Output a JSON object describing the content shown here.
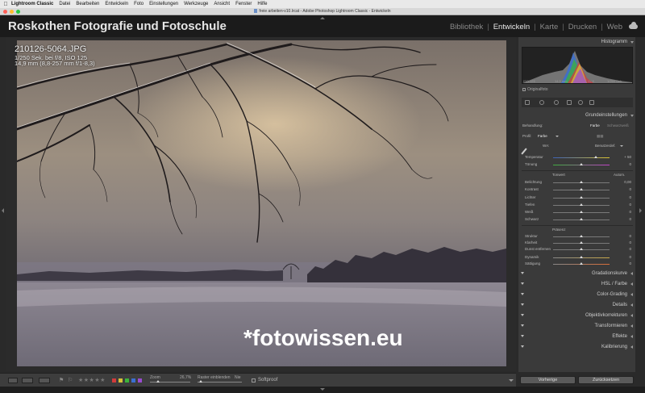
{
  "menubar": {
    "app_name": "Lightroom Classic",
    "items": [
      "Datei",
      "Bearbeiten",
      "Entwickeln",
      "Foto",
      "Einstellungen",
      "Werkzeuge",
      "Ansicht",
      "Fenster",
      "Hilfe"
    ]
  },
  "window": {
    "title": "freie arbeiten-v10.lrcat - Adobe Photoshop Lightroom Classic - Entwickeln"
  },
  "identity": {
    "studio_name": "Roskothen Fotografie und Fotoschule"
  },
  "modules": {
    "items": [
      "Bibliothek",
      "Entwickeln",
      "Karte",
      "Drucken",
      "Web"
    ],
    "active": "Entwickeln"
  },
  "image_info": {
    "filename": "210126-5064.JPG",
    "exif": "1/250 Sek. bei f/8, ISO 125",
    "lens": "14,9 mm (8,8-257 mm f/1-8,3)"
  },
  "watermark": "*fotowissen.eu",
  "toolbar": {
    "zoom_label": "Zoom",
    "zoom_value": "26,7%",
    "raster_label": "Raster einblenden",
    "raster_value": "Nie",
    "softproof_label": "Softproof"
  },
  "panel": {
    "histogram": {
      "title": "Histogramm",
      "meta_left": "ISO 125",
      "meta_mid": "14,9 mm",
      "meta_right": "f / 8",
      "meta_far": "1/250 Sek.",
      "original_label": "Originalfoto"
    },
    "basic": {
      "title": "Grundeinstellungen",
      "treatment_label": "Behandlung:",
      "treatment_color": "Farbe",
      "treatment_bw": "Schwarzweiß",
      "profile_label": "Profil:",
      "profile_value": "Farbe",
      "wb_label": "WA:",
      "wb_value": "Benutzerdef.",
      "sliders": {
        "temperature": {
          "label": "Temperatur",
          "value": "+ 50"
        },
        "tint": {
          "label": "Tönung",
          "value": "0"
        }
      },
      "tone_label": "Tonwert",
      "auto_label": "Autom.",
      "tone_sliders": [
        {
          "label": "Belichtung",
          "value": "0,00"
        },
        {
          "label": "Kontrast",
          "value": "0"
        },
        {
          "label": "Lichter",
          "value": "0"
        },
        {
          "label": "Tiefen",
          "value": "0"
        },
        {
          "label": "Weiß",
          "value": "0"
        },
        {
          "label": "Schwarz",
          "value": "0"
        }
      ],
      "presence_label": "Präsenz",
      "presence_sliders": [
        {
          "label": "Struktur",
          "value": "0"
        },
        {
          "label": "Klarheit",
          "value": "0"
        },
        {
          "label": "Dunst entfernen",
          "value": "0"
        },
        {
          "label": "Dynamik",
          "value": "0"
        },
        {
          "label": "Sättigung",
          "value": "0"
        }
      ]
    },
    "sections": [
      {
        "title": "Gradationskurve"
      },
      {
        "title": "HSL / Farbe"
      },
      {
        "title": "Color-Grading"
      },
      {
        "title": "Details"
      },
      {
        "title": "Objektivkorrekturen"
      },
      {
        "title": "Transformieren"
      },
      {
        "title": "Effekte"
      },
      {
        "title": "Kalibrierung"
      }
    ],
    "buttons": {
      "previous": "Vorherige",
      "reset": "Zurücksetzen"
    }
  },
  "colors": {
    "accent_red": "#ff5f57",
    "accent_yellow": "#febc2e",
    "accent_green": "#28c840",
    "label_red": "#d23b3b",
    "label_yellow": "#d8c23a",
    "label_green": "#3bb33b",
    "label_blue": "#3b6fd2",
    "label_purple": "#9a4bd2"
  }
}
